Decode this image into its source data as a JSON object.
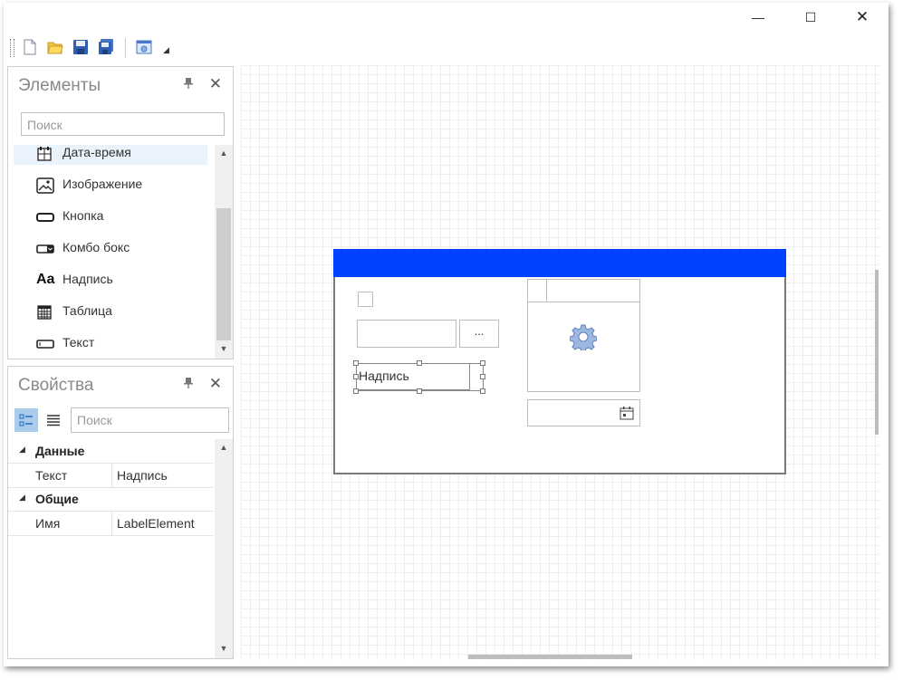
{
  "window": {
    "controls": {
      "minimize": "—",
      "maximize": "☐",
      "close": "✕"
    }
  },
  "toolbar": {
    "icons": [
      "new-file-icon",
      "open-folder-icon",
      "save-icon",
      "save-all-icon",
      "form-preview-icon"
    ],
    "overflow": "◢"
  },
  "elements_panel": {
    "title": "Элементы",
    "pin": "📌",
    "close": "✕",
    "search_placeholder": "Поиск",
    "items": [
      {
        "label": "Дата-время",
        "icon": "datetime-icon"
      },
      {
        "label": "Изображение",
        "icon": "image-icon"
      },
      {
        "label": "Кнопка",
        "icon": "button-icon"
      },
      {
        "label": "Комбо бокс",
        "icon": "combobox-icon"
      },
      {
        "label": "Надпись",
        "icon": "label-icon",
        "glyph": "Aa"
      },
      {
        "label": "Таблица",
        "icon": "table-icon"
      },
      {
        "label": "Текст",
        "icon": "textbox-icon"
      }
    ]
  },
  "properties_panel": {
    "title": "Свойства",
    "pin": "📌",
    "close": "✕",
    "search_placeholder": "Поиск",
    "groups": [
      {
        "name": "Данные",
        "rows": [
          {
            "key": "Текст",
            "value": "Надпись"
          }
        ]
      },
      {
        "name": "Общие",
        "rows": [
          {
            "key": "Имя",
            "value": "LabelElement"
          }
        ]
      }
    ]
  },
  "canvas": {
    "form_header_color": "#0040ff",
    "ellipsis_button": "...",
    "selected_label_text": "Надпись"
  }
}
